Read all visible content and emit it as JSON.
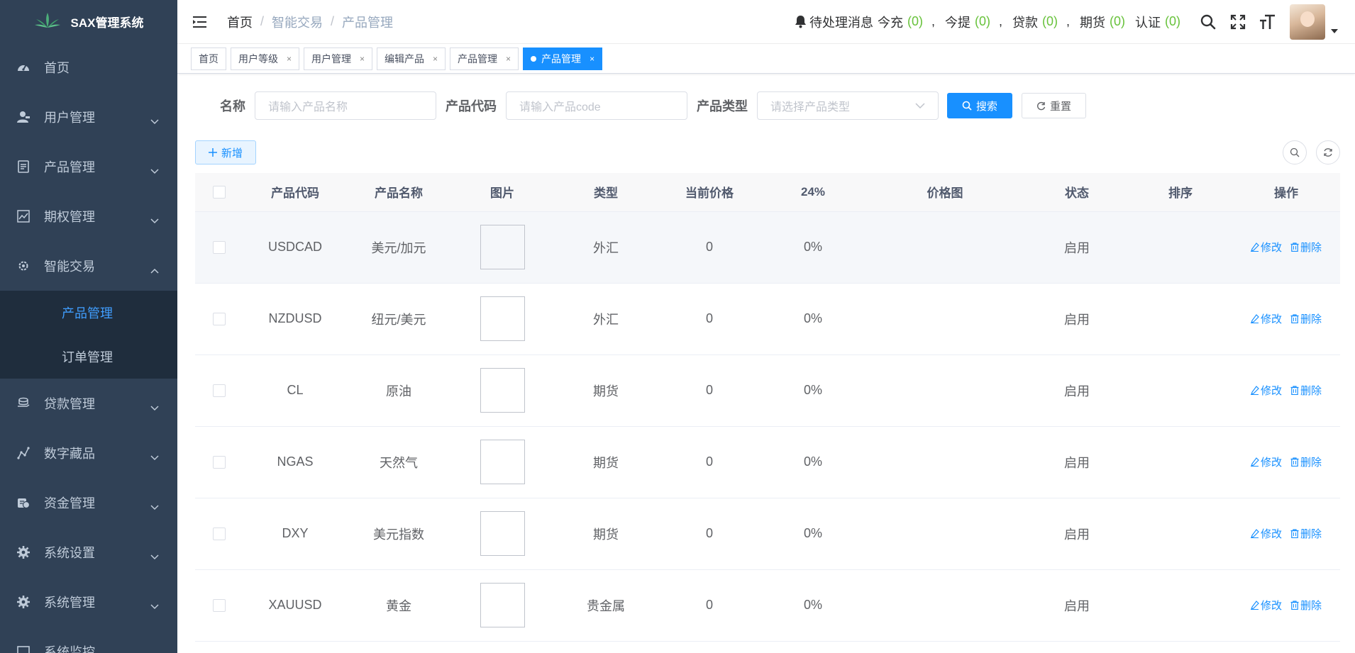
{
  "app": {
    "title": "SAX管理系统"
  },
  "sidebar": {
    "items": [
      {
        "label": "首页",
        "icon": "dashboard-icon"
      },
      {
        "label": "用户管理",
        "icon": "user-icon"
      },
      {
        "label": "产品管理",
        "icon": "document-icon"
      },
      {
        "label": "期权管理",
        "icon": "chart-icon"
      },
      {
        "label": "智能交易",
        "icon": "gear-icon"
      },
      {
        "label": "产品管理"
      },
      {
        "label": "订单管理"
      },
      {
        "label": "贷款管理",
        "icon": "coins-icon"
      },
      {
        "label": "数字藏品",
        "icon": "graph-icon"
      },
      {
        "label": "资金管理",
        "icon": "money-icon"
      },
      {
        "label": "系统设置",
        "icon": "settings-icon"
      },
      {
        "label": "系统管理",
        "icon": "settings-icon"
      },
      {
        "label": "系统监控",
        "icon": "monitor-icon"
      }
    ]
  },
  "header": {
    "breadcrumb": [
      "首页",
      "智能交易",
      "产品管理"
    ],
    "notice": {
      "label": "待处理消息",
      "items": [
        {
          "label": "今充",
          "count": "(0)"
        },
        {
          "label": "今提",
          "count": "(0)"
        },
        {
          "label": "贷款",
          "count": "(0)"
        },
        {
          "label": "期货",
          "count": "(0)"
        },
        {
          "label": "认证",
          "count": "(0)"
        }
      ],
      "separator": ","
    }
  },
  "tags": [
    {
      "label": "首页",
      "closable": false
    },
    {
      "label": "用户等级",
      "closable": true
    },
    {
      "label": "用户管理",
      "closable": true
    },
    {
      "label": "编辑产品",
      "closable": true
    },
    {
      "label": "产品管理",
      "closable": true
    },
    {
      "label": "产品管理",
      "closable": true,
      "active": true
    }
  ],
  "tag_close": "×",
  "search": {
    "name_label": "名称",
    "name_placeholder": "请输入产品名称",
    "code_label": "产品代码",
    "code_placeholder": "请输入产品code",
    "type_label": "产品类型",
    "type_placeholder": "请选择产品类型",
    "search_btn": "搜索",
    "reset_btn": "重置"
  },
  "toolbar": {
    "add_label": "新增"
  },
  "table": {
    "columns": [
      "产品代码",
      "产品名称",
      "图片",
      "类型",
      "当前价格",
      "24%",
      "价格图",
      "状态",
      "排序",
      "操作"
    ],
    "edit_label": "修改",
    "delete_label": "删除",
    "rows": [
      {
        "code": "USDCAD",
        "name": "美元/加元",
        "type": "外汇",
        "price": "0",
        "change": "0%",
        "status": "启用"
      },
      {
        "code": "NZDUSD",
        "name": "纽元/美元",
        "type": "外汇",
        "price": "0",
        "change": "0%",
        "status": "启用"
      },
      {
        "code": "CL",
        "name": "原油",
        "type": "期货",
        "price": "0",
        "change": "0%",
        "status": "启用"
      },
      {
        "code": "NGAS",
        "name": "天然气",
        "type": "期货",
        "price": "0",
        "change": "0%",
        "status": "启用"
      },
      {
        "code": "DXY",
        "name": "美元指数",
        "type": "期货",
        "price": "0",
        "change": "0%",
        "status": "启用"
      },
      {
        "code": "XAUUSD",
        "name": "黄金",
        "type": "贵金属",
        "price": "0",
        "change": "0%",
        "status": "启用"
      }
    ]
  },
  "colors": {
    "sidebar_bg": "#304156",
    "submenu_bg": "#1f2d3d",
    "accent": "#1890ff",
    "count_green": "#67c23a"
  }
}
